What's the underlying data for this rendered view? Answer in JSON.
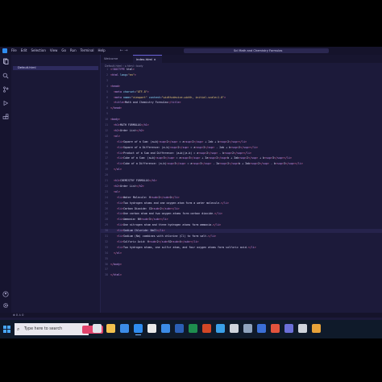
{
  "menu": [
    "File",
    "Edit",
    "Selection",
    "View",
    "Go",
    "Run",
    "Terminal",
    "Help"
  ],
  "nav_arrows": "← →",
  "search_title": "Sci Math and Chemistry Formulas",
  "sidebar_row": "Default.html",
  "tabs": [
    {
      "label": "Welcome"
    },
    {
      "label": "index.html ×"
    }
  ],
  "breadcrumb": "Default.html › ⌂ html › body",
  "code_lines": [
    "<!DOCTYPE html>",
    "<html lang=\"en\">",
    "",
    "<head>",
    "  <meta charset=\"UTF-8\">",
    "  <meta name=\"viewport\" content=\"width=device-width, initial-scale=1.0\">",
    "  <title>Math and Chemistry Formulas</title>",
    "</head>",
    "",
    "<body>",
    "  <h1>MATH FORMULAS</h1>",
    "  <h2>Order List</h2>",
    "  <ol>",
    "    <li>Square of a Sum: (a+b)<sup>2</sup> = a<sup>2</sup> + 2ab + b<sup>2</sup></li>",
    "    <li>Square of a Difference: (a-b)<sup>2</sup> = a<sup>2</sup> - 2ab + b<sup>2</sup></li>",
    "    <li>Product of a Sum and Difference: (a+b)(a-b) = a<sup>2</sup> - b<sup>2</sup></li>",
    "    <li>Cube of a Sum: (a+b)<sup>3</sup> = a<sup>3</sup> + 3a<sup>2</sup>b + 3ab<sup>2</sup> + b<sup>3</sup></li>",
    "    <li>Cube of a Difference: (a-b)<sup>3</sup> = a<sup>3</sup> - 3a<sup>2</sup>b + 3ab<sup>2</sup> - b<sup>3</sup></li>",
    "  </ol>",
    "",
    "  <h1>CHEMISTRY FORMULAS</h1>",
    "  <h2>Order List</h2>",
    "  <ol>",
    "    <li>Water Molecule: H<sub>2</sub>O</li>",
    "    <li>Two hydrogen atoms and one oxygen atom form a water molecule.</li>",
    "    <li>Carbon Dioxide: CO<sub>2</sub></li>",
    "    <li>One carbon atom and two oxygen atoms form carbon dioxide.</li>",
    "    <li>Ammonia: NH<sub>3</sub></li>",
    "    <li>One nitrogen atom and three hydrogen atoms form ammonia.</li>",
    "    <li>Sodium Chloride: NaCl</li>",
    "    <li>Sodium (Na) combines with chlorine (Cl) to form salt.</li>",
    "    <li>Sulfuric Acid: H<sub>2</sub>SO<sub>4</sub></li>",
    "    <li>Two hydrogen atoms, one sulfur atom, and four oxygen atoms form sulfuric acid.</li>",
    "  </ol>",
    "",
    "</body>",
    "",
    "</html>"
  ],
  "current_line": 30,
  "taskbar_search_placeholder": "Type here to search",
  "colors": {
    "tag": "#f47fb4",
    "attr": "#8ddcff",
    "string": "#e9c97a",
    "keyword": "#c792ea",
    "text": "#d9d6f3"
  },
  "taskbar_icons": [
    "task-view-icon",
    "file-explorer-icon",
    "store-icon",
    "vscode-icon",
    "chrome-icon",
    "mail-icon",
    "word-icon",
    "excel-icon",
    "powerpoint-icon",
    "edge-icon",
    "app-icon",
    "app-icon",
    "app-icon",
    "app-icon",
    "app-icon",
    "app-icon",
    "app-icon"
  ]
}
